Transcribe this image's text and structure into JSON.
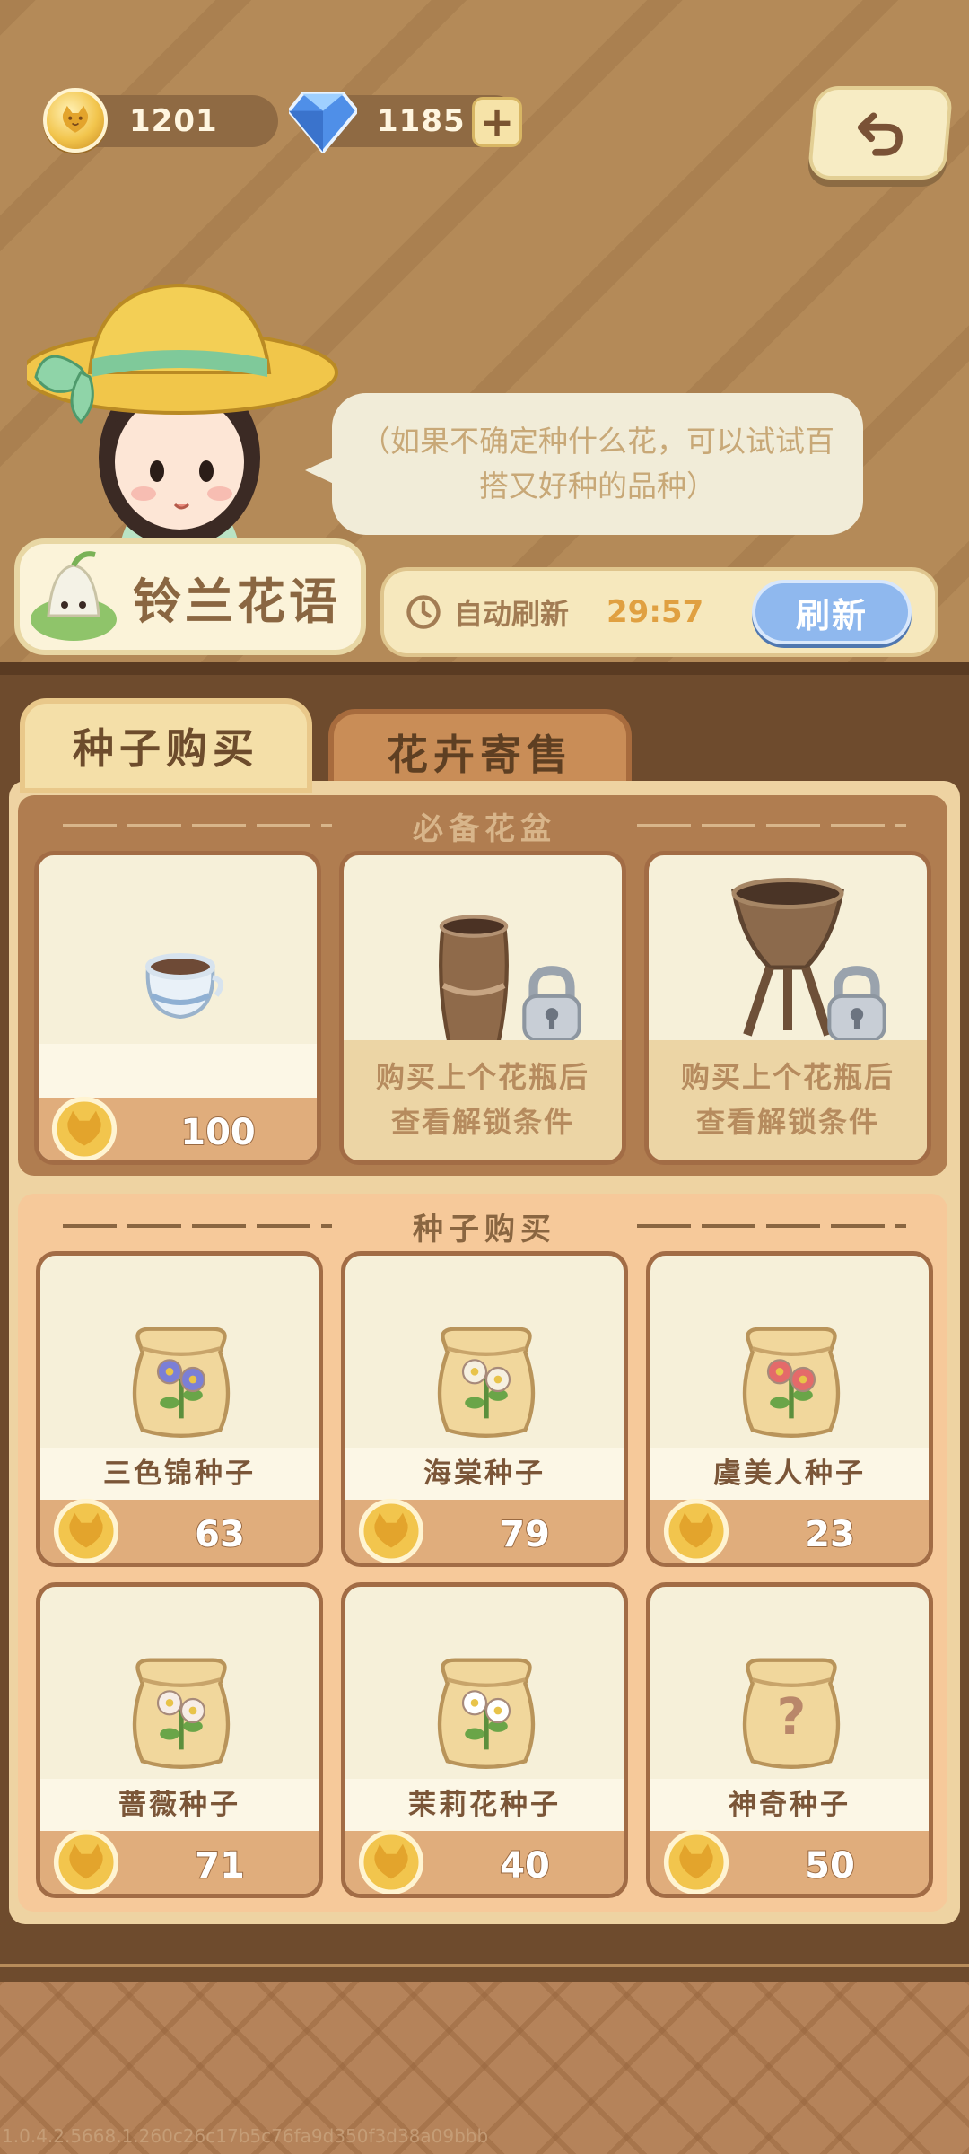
{
  "currency": {
    "coins": "1201",
    "gems": "1185",
    "add_gems_icon": "plus-icon",
    "back_icon": "undo-arrow-icon"
  },
  "npc": {
    "dialogue": "（如果不确定种什么花，可以试试百搭又好种的品种）"
  },
  "shop": {
    "title": "铃兰花语",
    "auto_refresh_label": "自动刷新",
    "timer": "29:57",
    "refresh_label": "刷新",
    "tabs": [
      {
        "label": "种子购买",
        "active": true
      },
      {
        "label": "花卉寄售",
        "active": false
      }
    ]
  },
  "pots": {
    "title": "必备花盆",
    "items": [
      {
        "price": "100",
        "locked": false,
        "icon": "white-jar-pot-icon"
      },
      {
        "locked": true,
        "lock_text": "购买上个花瓶后查看解锁条件",
        "icon": "clay-vase-icon"
      },
      {
        "locked": true,
        "lock_text": "购买上个花瓶后查看解锁条件",
        "icon": "wicker-stand-pot-icon"
      }
    ]
  },
  "seeds": {
    "title": "种子购买",
    "items": [
      {
        "name": "三色锦种子",
        "price": "63",
        "flower_color": "#7b7fd6"
      },
      {
        "name": "海棠种子",
        "price": "79",
        "flower_color": "#f6f0e0"
      },
      {
        "name": "虞美人种子",
        "price": "23",
        "flower_color": "#e46a6a"
      },
      {
        "name": "蔷薇种子",
        "price": "71",
        "flower_color": "#f7ede6"
      },
      {
        "name": "茉莉花种子",
        "price": "40",
        "flower_color": "#ffffff"
      },
      {
        "name": "神奇种子",
        "price": "50",
        "flower_color": "#b9876a"
      }
    ]
  },
  "build_id": "1.0.4.2.5668.1.260c26c17b5c76fa9d350f3d38a09bbb",
  "colors": {
    "accent_brown": "#6e4b2d",
    "refresh_blue": "#8fb8ee",
    "timer_orange": "#e0a041"
  }
}
